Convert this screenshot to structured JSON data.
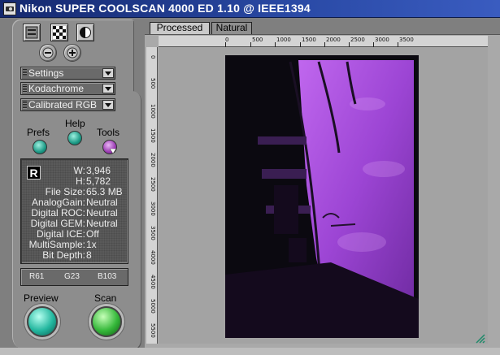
{
  "window": {
    "title": "Nikon SUPER COOLSCAN 4000 ED 1.10 @ IEEE1394"
  },
  "toolbar": {
    "icons": [
      "film-strip-icon",
      "checker-icon",
      "contrast-icon",
      "zoom-out-icon",
      "zoom-in-icon"
    ]
  },
  "dropdowns": [
    {
      "label": "Settings"
    },
    {
      "label": "Kodachrome"
    },
    {
      "label": "Calibrated RGB"
    }
  ],
  "buttons": {
    "prefs": "Prefs",
    "help": "Help",
    "tools": "Tools",
    "preview": "Preview",
    "scan": "Scan"
  },
  "info": {
    "channel": "R",
    "rows": [
      {
        "key": "W:",
        "value": "3,946"
      },
      {
        "key": "H:",
        "value": "5,782"
      },
      {
        "key": "File Size:",
        "value": "65.3 MB"
      },
      {
        "key": "AnalogGain:",
        "value": "Neutral"
      },
      {
        "key": "Digital ROC:",
        "value": "Neutral"
      },
      {
        "key": "Digital GEM:",
        "value": "Neutral"
      },
      {
        "key": "Digital ICE:",
        "value": "Off"
      },
      {
        "key": "MultiSample:",
        "value": "1x"
      },
      {
        "key": "Bit Depth:",
        "value": "8"
      }
    ]
  },
  "rgb": {
    "r": "R61",
    "g": "G23",
    "b": "B103"
  },
  "tabs": {
    "processed": "Processed",
    "natural": "Natural"
  },
  "ruler": {
    "top": [
      "0",
      "500",
      "1000",
      "1500",
      "2000",
      "2500",
      "3000",
      "3500"
    ],
    "left": [
      "0",
      "500",
      "1000",
      "1500",
      "2000",
      "2500",
      "3000",
      "3500",
      "4000",
      "4500",
      "5000",
      "5500"
    ]
  },
  "colors": {
    "title_bar": "#1f3a8f",
    "panel": "#8d8d8d",
    "photo_sky": "#a24fd6",
    "preview_button": "#1fa58e",
    "scan_button": "#2fae32"
  }
}
